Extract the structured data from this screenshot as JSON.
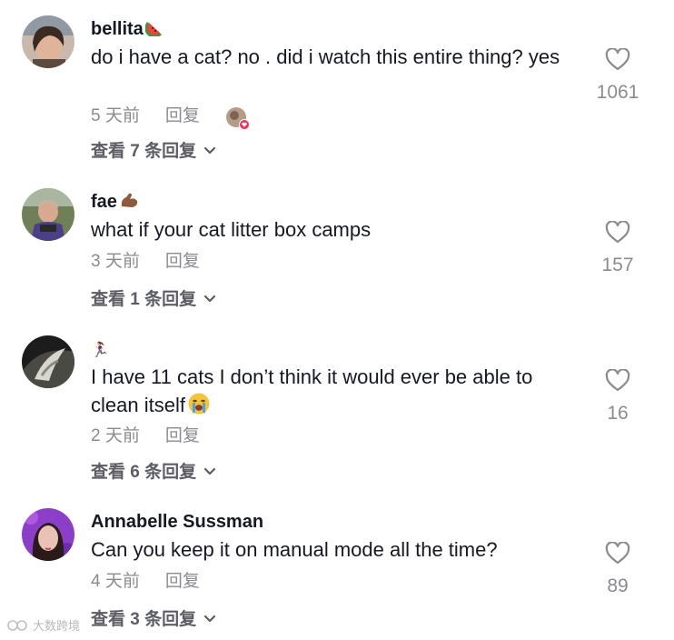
{
  "colors": {
    "text_primary": "#161823",
    "text_secondary": "#8a8b91",
    "reply_link": "#5c5d64",
    "like_badge": "#fe2c55"
  },
  "comments": [
    {
      "username": "bellita",
      "username_emoji": "watermelon-icon",
      "text": "do i have a cat? no . did i watch this entire thing? yes",
      "time": "5 天前",
      "reply_label": "回复",
      "view_replies": "查看 7 条回复",
      "likes": "1061",
      "creator_liked": true
    },
    {
      "username": "fae",
      "username_emoji": "flexed-biceps-icon",
      "text": "what if your cat litter box camps",
      "time": "3 天前",
      "reply_label": "回复",
      "view_replies": "查看 1 条回复",
      "likes": "157"
    },
    {
      "username": "🏃‍♀️",
      "text": "I have 11 cats I don’t think it would ever be able to clean itself",
      "text_emoji": "loudly-crying-face-icon",
      "time": "2 天前",
      "reply_label": "回复",
      "view_replies": "查看 6 条回复",
      "likes": "16"
    },
    {
      "username": "Annabelle Sussman",
      "text": "Can you keep it on manual mode all the time?",
      "time": "4 天前",
      "reply_label": "回复",
      "view_replies": "查看 3 条回复",
      "likes": "89"
    }
  ],
  "watermark": "大数跨境"
}
